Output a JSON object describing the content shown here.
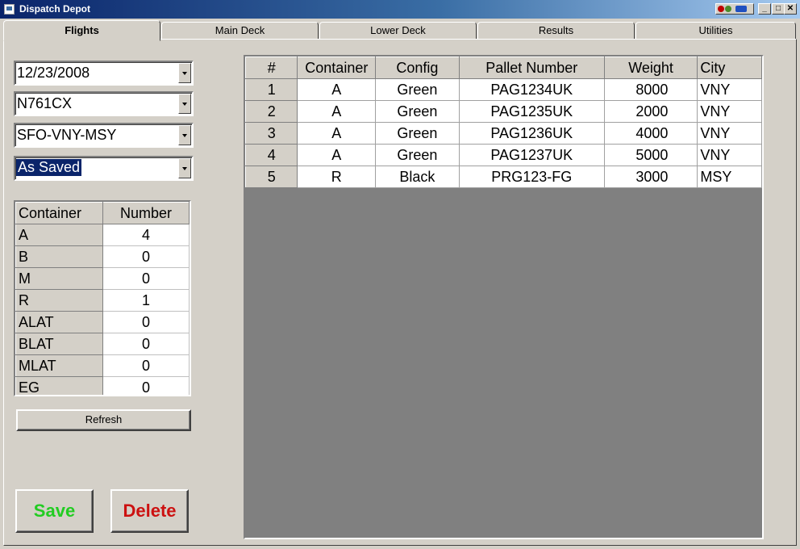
{
  "window": {
    "title": "Dispatch Depot"
  },
  "tabs": [
    {
      "label": "Flights",
      "active": true
    },
    {
      "label": "Main Deck",
      "active": false
    },
    {
      "label": "Lower Deck",
      "active": false
    },
    {
      "label": "Results",
      "active": false
    },
    {
      "label": "Utilities",
      "active": false
    }
  ],
  "filters": {
    "date": "12/23/2008",
    "tail_number": "N761CX",
    "route": "SFO-VNY-MSY",
    "mode": "As Saved"
  },
  "container_counts": {
    "headers": [
      "Container",
      "Number"
    ],
    "rows": [
      {
        "container": "A",
        "number": "4"
      },
      {
        "container": "B",
        "number": "0"
      },
      {
        "container": "M",
        "number": "0"
      },
      {
        "container": "R",
        "number": "1"
      },
      {
        "container": "ALAT",
        "number": "0"
      },
      {
        "container": "BLAT",
        "number": "0"
      },
      {
        "container": "MLAT",
        "number": "0"
      },
      {
        "container": "EG",
        "number": "0"
      }
    ]
  },
  "buttons": {
    "refresh": "Refresh",
    "save": "Save",
    "delete": "Delete"
  },
  "pallets": {
    "headers": [
      "#",
      "Container",
      "Config",
      "Pallet Number",
      "Weight",
      "City"
    ],
    "rows": [
      {
        "n": "1",
        "container": "A",
        "config": "Green",
        "pallet": "PAG1234UK",
        "weight": "8000",
        "city": "VNY"
      },
      {
        "n": "2",
        "container": "A",
        "config": "Green",
        "pallet": "PAG1235UK",
        "weight": "2000",
        "city": "VNY"
      },
      {
        "n": "3",
        "container": "A",
        "config": "Green",
        "pallet": "PAG1236UK",
        "weight": "4000",
        "city": "VNY"
      },
      {
        "n": "4",
        "container": "A",
        "config": "Green",
        "pallet": "PAG1237UK",
        "weight": "5000",
        "city": "VNY"
      },
      {
        "n": "5",
        "container": "R",
        "config": "Black",
        "pallet": "PRG123-FG",
        "weight": "3000",
        "city": "MSY"
      }
    ]
  },
  "colors": {
    "save": "#22cc22",
    "delete": "#cc1111",
    "title_bar": "#0a246a"
  }
}
